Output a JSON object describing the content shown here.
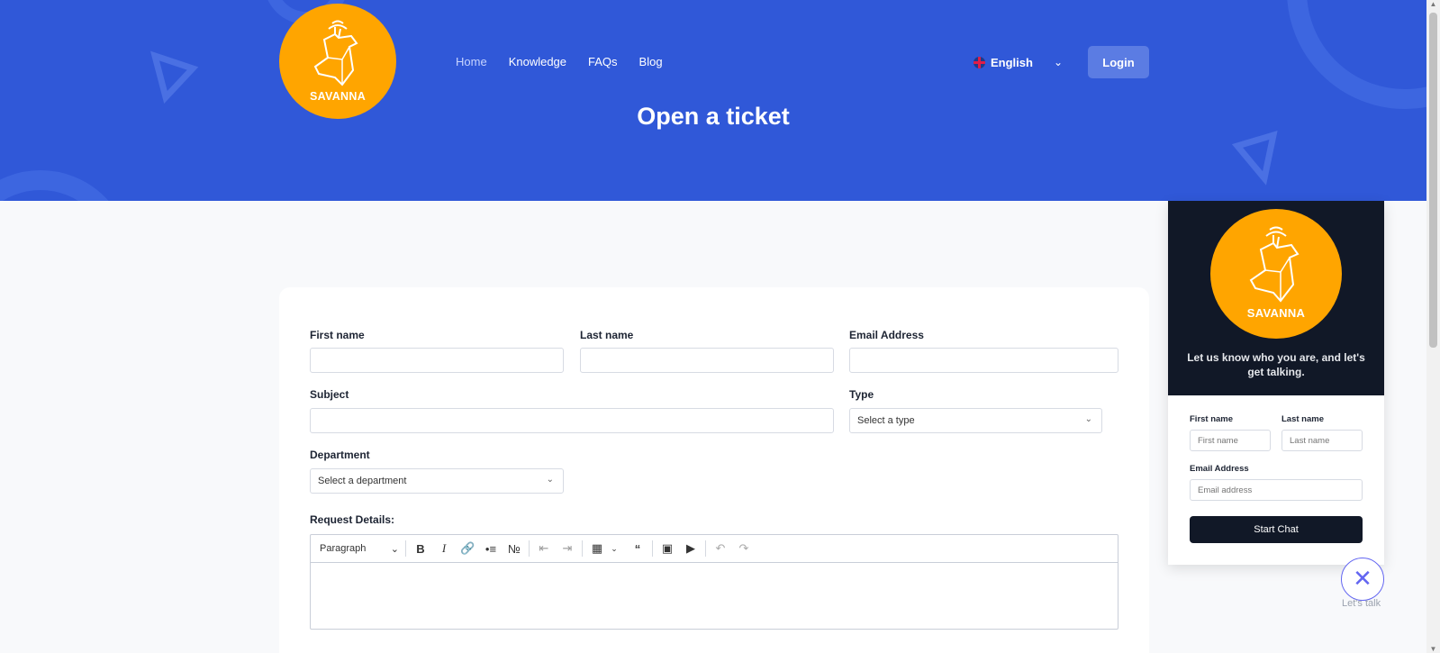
{
  "brand": {
    "name": "SAVANNA"
  },
  "nav": {
    "items": [
      "Home",
      "Knowledge",
      "FAQs",
      "Blog"
    ],
    "active": "Home"
  },
  "lang": {
    "label": "English"
  },
  "header": {
    "login": "Login",
    "title": "Open a ticket"
  },
  "form": {
    "first_name": "First name",
    "last_name": "Last name",
    "email": "Email Address",
    "subject": "Subject",
    "type": "Type",
    "type_placeholder": "Select a type",
    "department": "Department",
    "department_placeholder": "Select a department",
    "details": "Request Details:",
    "paragraph": "Paragraph"
  },
  "chat": {
    "intro": "Let us know who you are, and let's get talking.",
    "first_name_label": "First name",
    "first_name_placeholder": "First name",
    "last_name_label": "Last name",
    "last_name_placeholder": "Last name",
    "email_label": "Email Address",
    "email_placeholder": "Email address",
    "start": "Start Chat",
    "fab_label": "Let's talk"
  },
  "colors": {
    "hero": "#3058d8",
    "brand_orange": "#ffa500",
    "dark": "#111827",
    "accent": "#6366f1"
  }
}
